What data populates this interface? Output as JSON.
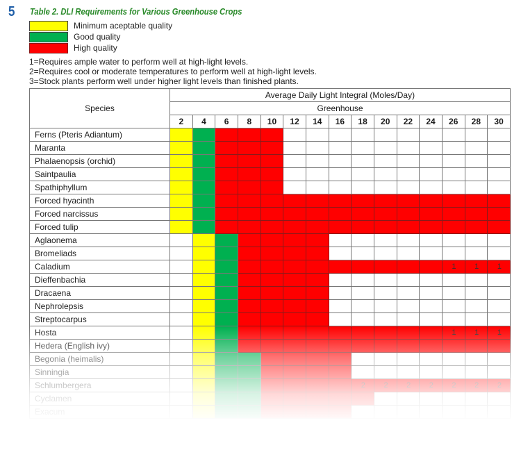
{
  "section_number": "5",
  "title": "Table 2. DLI Requirements for Various Greenhouse Crops",
  "legend": [
    {
      "label": "Minimum aceptable quality",
      "color": "#ffff00",
      "code": "y"
    },
    {
      "label": "Good quality",
      "color": "#00b050",
      "code": "g"
    },
    {
      "label": "High quality",
      "color": "#ff0000",
      "code": "r"
    }
  ],
  "notes": [
    "1=Requires ample water to perform well at high-light levels.",
    "2=Requires cool or moderate temperatures to perform well at high-light levels.",
    "3=Stock plants perform well under higher light levels than finished plants."
  ],
  "table": {
    "species_header": "Species",
    "group_header": "Average Daily Light Integral (Moles/Day)",
    "sub_header": "Greenhouse",
    "columns": [
      "2",
      "4",
      "6",
      "8",
      "10",
      "12",
      "14",
      "16",
      "18",
      "20",
      "22",
      "24",
      "26",
      "28",
      "30"
    ],
    "rows": [
      {
        "species": "Ferns (Pteris Adiantum)",
        "cells": [
          "y",
          "g",
          "r",
          "r",
          "r",
          "",
          "",
          "",
          "",
          "",
          "",
          "",
          "",
          "",
          ""
        ],
        "notes": {}
      },
      {
        "species": "Maranta",
        "cells": [
          "y",
          "g",
          "r",
          "r",
          "r",
          "",
          "",
          "",
          "",
          "",
          "",
          "",
          "",
          "",
          ""
        ],
        "notes": {}
      },
      {
        "species": "Phalaenopsis (orchid)",
        "cells": [
          "y",
          "g",
          "r",
          "r",
          "r",
          "",
          "",
          "",
          "",
          "",
          "",
          "",
          "",
          "",
          ""
        ],
        "notes": {}
      },
      {
        "species": "Saintpaulia",
        "cells": [
          "y",
          "g",
          "r",
          "r",
          "r",
          "",
          "",
          "",
          "",
          "",
          "",
          "",
          "",
          "",
          ""
        ],
        "notes": {}
      },
      {
        "species": "Spathiphyllum",
        "cells": [
          "y",
          "g",
          "r",
          "r",
          "r",
          "",
          "",
          "",
          "",
          "",
          "",
          "",
          "",
          "",
          ""
        ],
        "notes": {}
      },
      {
        "species": "Forced hyacinth",
        "cells": [
          "y",
          "g",
          "r",
          "r",
          "r",
          "r",
          "r",
          "r",
          "r",
          "r",
          "r",
          "r",
          "r",
          "r",
          "r"
        ],
        "notes": {}
      },
      {
        "species": "Forced narcissus",
        "cells": [
          "y",
          "g",
          "r",
          "r",
          "r",
          "r",
          "r",
          "r",
          "r",
          "r",
          "r",
          "r",
          "r",
          "r",
          "r"
        ],
        "notes": {}
      },
      {
        "species": "Forced tulip",
        "cells": [
          "y",
          "g",
          "r",
          "r",
          "r",
          "r",
          "r",
          "r",
          "r",
          "r",
          "r",
          "r",
          "r",
          "r",
          "r"
        ],
        "notes": {}
      },
      {
        "species": "Aglaonema",
        "cells": [
          "",
          "y",
          "g",
          "r",
          "r",
          "r",
          "r",
          "",
          "",
          "",
          "",
          "",
          "",
          "",
          ""
        ],
        "notes": {}
      },
      {
        "species": "Bromeliads",
        "cells": [
          "",
          "y",
          "g",
          "r",
          "r",
          "r",
          "r",
          "",
          "",
          "",
          "",
          "",
          "",
          "",
          ""
        ],
        "notes": {}
      },
      {
        "species": "Caladium",
        "cells": [
          "",
          "y",
          "g",
          "r",
          "r",
          "r",
          "r",
          "r",
          "r",
          "r",
          "r",
          "r",
          "r",
          "r",
          "r"
        ],
        "notes": {
          "12": "1",
          "13": "1",
          "14": "1"
        }
      },
      {
        "species": "Dieffenbachia",
        "cells": [
          "",
          "y",
          "g",
          "r",
          "r",
          "r",
          "r",
          "",
          "",
          "",
          "",
          "",
          "",
          "",
          ""
        ],
        "notes": {}
      },
      {
        "species": "Dracaena",
        "cells": [
          "",
          "y",
          "g",
          "r",
          "r",
          "r",
          "r",
          "",
          "",
          "",
          "",
          "",
          "",
          "",
          ""
        ],
        "notes": {}
      },
      {
        "species": "Nephrolepsis",
        "cells": [
          "",
          "y",
          "g",
          "r",
          "r",
          "r",
          "r",
          "",
          "",
          "",
          "",
          "",
          "",
          "",
          ""
        ],
        "notes": {}
      },
      {
        "species": "Streptocarpus",
        "cells": [
          "",
          "y",
          "g",
          "r",
          "r",
          "r",
          "r",
          "",
          "",
          "",
          "",
          "",
          "",
          "",
          ""
        ],
        "notes": {}
      },
      {
        "species": "Hosta",
        "cells": [
          "",
          "y",
          "g",
          "r",
          "r",
          "r",
          "r",
          "r",
          "r",
          "r",
          "r",
          "r",
          "r",
          "r",
          "r"
        ],
        "notes": {
          "12": "1",
          "13": "1",
          "14": "1"
        }
      },
      {
        "species": "Hedera (English ivy)",
        "cells": [
          "",
          "y",
          "g",
          "r",
          "r",
          "r",
          "r",
          "r",
          "r",
          "r",
          "r",
          "r",
          "r",
          "r",
          "r"
        ],
        "notes": {}
      },
      {
        "species": "Begonia (heimalis)",
        "cells": [
          "",
          "y",
          "g",
          "g",
          "r",
          "r",
          "r",
          "r",
          "",
          "",
          "",
          "",
          "",
          "",
          ""
        ],
        "notes": {}
      },
      {
        "species": "Sinningia",
        "cells": [
          "",
          "y",
          "g",
          "g",
          "r",
          "r",
          "r",
          "r",
          "",
          "",
          "",
          "",
          "",
          "",
          ""
        ],
        "notes": {}
      },
      {
        "species": "Schlumbergera",
        "cells": [
          "",
          "y",
          "g",
          "g",
          "r",
          "r",
          "r",
          "r",
          "r",
          "r",
          "r",
          "r",
          "r",
          "r",
          "r"
        ],
        "notes": {
          "8": "2",
          "9": "2",
          "10": "2",
          "11": "2",
          "12": "2",
          "13": "2",
          "14": "2"
        }
      },
      {
        "species": "Cyclamen",
        "cells": [
          "",
          "y",
          "g",
          "g",
          "r",
          "r",
          "r",
          "r",
          "r",
          "",
          "",
          "",
          "",
          "",
          ""
        ],
        "notes": {}
      },
      {
        "species": "Exacum",
        "cells": [
          "",
          "y",
          "g",
          "g",
          "r",
          "r",
          "r",
          "r",
          "",
          "",
          "",
          "",
          "",
          "",
          ""
        ],
        "notes": {}
      }
    ]
  }
}
